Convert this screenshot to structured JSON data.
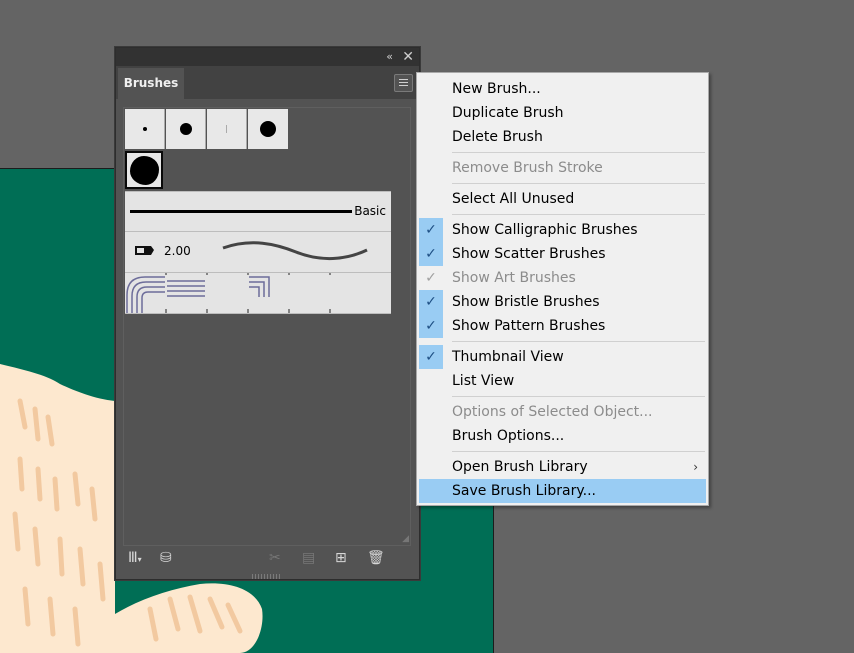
{
  "panel": {
    "tab_label": "Brushes",
    "collapse_icon": "double-chevron-left-icon",
    "close_icon": "close-icon",
    "calligraphic_size": "2.00",
    "basic_label": "Basic"
  },
  "bottom_toolbar": {
    "icons": [
      "brush-libraries-menu-icon",
      "libraries-panel-icon",
      "remove-brush-stroke-icon",
      "options-of-selected-object-icon",
      "new-brush-icon",
      "delete-brush-icon"
    ]
  },
  "context_menu": {
    "new_brush": "New Brush...",
    "duplicate_brush": "Duplicate Brush",
    "delete_brush": "Delete Brush",
    "remove_brush_stroke": "Remove Brush Stroke",
    "select_all_unused": "Select All Unused",
    "show_calligraphic": "Show Calligraphic Brushes",
    "show_scatter": "Show Scatter Brushes",
    "show_art": "Show Art Brushes",
    "show_bristle": "Show Bristle Brushes",
    "show_pattern": "Show Pattern Brushes",
    "thumbnail_view": "Thumbnail View",
    "list_view": "List View",
    "options_selected": "Options of Selected Object...",
    "brush_options": "Brush Options...",
    "open_library": "Open Brush Library",
    "save_library": "Save Brush Library...",
    "checkmark": "✓",
    "submenu_arrow": "›"
  },
  "colors": {
    "canvas": "#646464",
    "artboard": "#006e55",
    "menu_highlight": "#99ccf3",
    "panel": "#535353"
  }
}
